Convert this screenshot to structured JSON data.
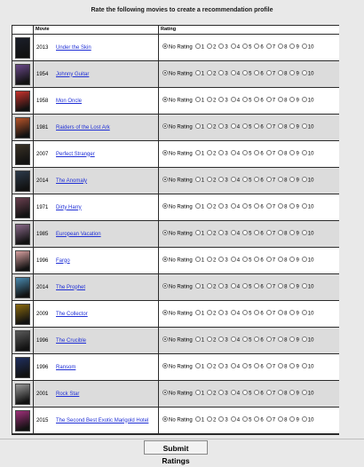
{
  "header": {
    "title": "Rate the following movies to create a recommendation profile"
  },
  "table": {
    "col_movie": "Movie",
    "col_rating": "Rating",
    "no_rating_label": "No Rating",
    "rating_options": [
      "1",
      "2",
      "3",
      "4",
      "5",
      "6",
      "7",
      "8",
      "9",
      "10"
    ],
    "rows": [
      {
        "year": "2013",
        "title": "Under the Skin",
        "poster_color": "#1b1f2a"
      },
      {
        "year": "1954",
        "title": "Johnny Guitar",
        "poster_color": "#6b4a8a"
      },
      {
        "year": "1958",
        "title": "Mon Oncle",
        "poster_color": "#c8322c"
      },
      {
        "year": "1981",
        "title": "Raiders of the Lost Ark",
        "poster_color": "#b8552a"
      },
      {
        "year": "2007",
        "title": "Perfect Stranger",
        "poster_color": "#3a3226"
      },
      {
        "year": "2014",
        "title": "The Anomaly",
        "poster_color": "#2c3a4a"
      },
      {
        "year": "1971",
        "title": "Dirty Harry",
        "poster_color": "#6a4050"
      },
      {
        "year": "1985",
        "title": "European Vacation",
        "poster_color": "#8a6a8a"
      },
      {
        "year": "1996",
        "title": "Fargo",
        "poster_color": "#d8a0a0"
      },
      {
        "year": "2014",
        "title": "The Prophet",
        "poster_color": "#4a8ab0"
      },
      {
        "year": "2009",
        "title": "The Collector",
        "poster_color": "#8a6a10"
      },
      {
        "year": "1996",
        "title": "The Crucible",
        "poster_color": "#5a5a5a"
      },
      {
        "year": "1996",
        "title": "Ransom",
        "poster_color": "#203060"
      },
      {
        "year": "2001",
        "title": "Rock Star",
        "poster_color": "#9a9a9a"
      },
      {
        "year": "2015",
        "title": "The Second Best Exotic Marigold Hotel",
        "poster_color": "#a0307a"
      }
    ]
  },
  "submit": {
    "label": "Submit Ratings"
  }
}
